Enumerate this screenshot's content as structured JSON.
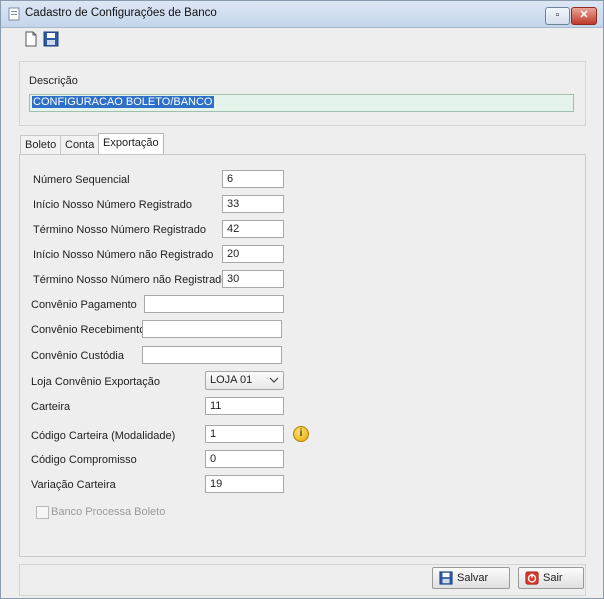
{
  "window": {
    "title": "Cadastro de Configurações de Banco",
    "restore_glyph": "▫",
    "close_glyph": "✕"
  },
  "toolbar": {
    "icons": [
      "new-document-icon",
      "save-icon"
    ]
  },
  "description": {
    "label": "Descrição",
    "value": "CONFIGURACAO BOLETO/BANCO"
  },
  "tabs": [
    {
      "label": "Boleto"
    },
    {
      "label": "Conta"
    },
    {
      "label": "Exportação",
      "active": true
    }
  ],
  "form": {
    "numero_sequencial": {
      "label": "Número Sequencial",
      "value": "6"
    },
    "inicio_nosso_registrado": {
      "label": "Início Nosso Número Registrado",
      "value": "33"
    },
    "termino_nosso_registrado": {
      "label": "Término Nosso Número Registrado",
      "value": "42"
    },
    "inicio_nosso_nao_registrado": {
      "label": "Início Nosso Número não Registrado",
      "value": "20"
    },
    "termino_nosso_nao_registrado": {
      "label": "Término Nosso Número não Registrado",
      "value": "30"
    },
    "convenio_pagamento": {
      "label": "Convênio Pagamento",
      "value": ""
    },
    "convenio_recebimento": {
      "label": "Convênio Recebimento",
      "value": ""
    },
    "convenio_custodia": {
      "label": "Convênio Custódia",
      "value": ""
    },
    "loja_convenio_exportacao": {
      "label": "Loja Convênio Exportação",
      "value": "LOJA 01"
    },
    "carteira": {
      "label": "Carteira",
      "value": "11"
    },
    "codigo_carteira": {
      "label": "Código Carteira (Modalidade)",
      "value": "1"
    },
    "codigo_compromisso": {
      "label": "Código Compromisso",
      "value": "0"
    },
    "variacao_carteira": {
      "label": "Variação Carteira",
      "value": "19"
    },
    "banco_processa_boleto": {
      "label": "Banco Processa Boleto",
      "checked": false
    }
  },
  "buttons": {
    "save": "Salvar",
    "exit": "Sair"
  },
  "colors": {
    "selection": "#2d6fc9",
    "description_bg": "#e5f4ea",
    "info": "#e2a800",
    "exit_icon": "#d9382c",
    "save_icon": "#2b5aa8"
  }
}
